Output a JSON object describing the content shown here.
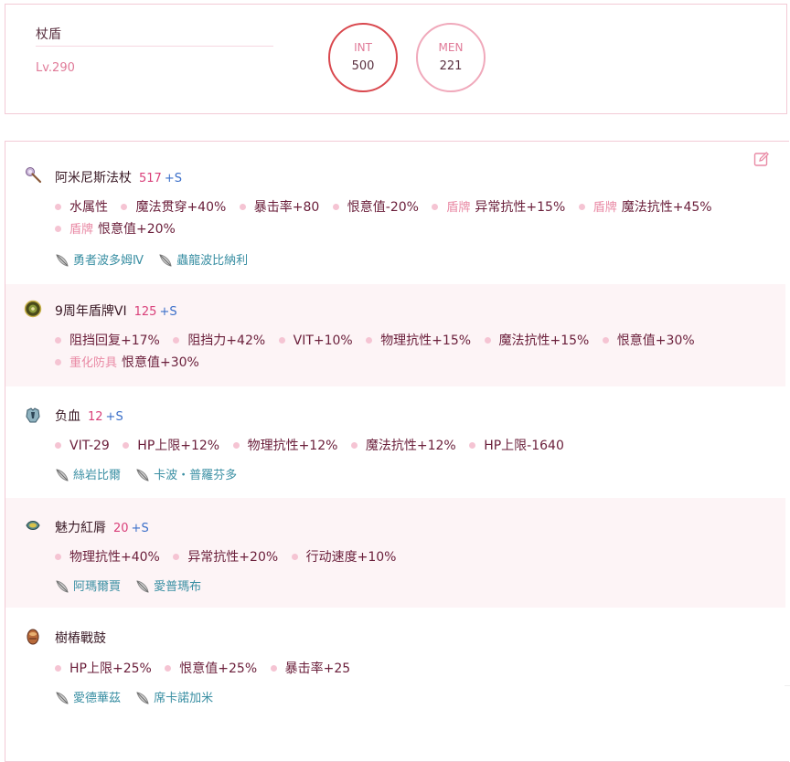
{
  "header": {
    "build_name": "杖盾",
    "level": "Lv.290",
    "stats": [
      {
        "label": "INT",
        "value": "500"
      },
      {
        "label": "MEN",
        "value": "221"
      }
    ]
  },
  "icons": {
    "edit": "edit-icon",
    "card": "card-feather-icon",
    "bullet": "bullet-dot"
  },
  "colors": {
    "accent_red": "#d9484e",
    "accent_pink": "#f0a9bb",
    "refine_pink": "#d9407a",
    "s_blue": "#3b6fc9",
    "card_teal": "#3a8fa3",
    "stat_text": "#6a1e3a"
  },
  "equipment": [
    {
      "name": "阿米尼斯法杖",
      "refine": "517",
      "suffix": "+S",
      "icon": "staff-icon",
      "stats_rows": [
        [
          {
            "prefix": "",
            "text": "水属性"
          },
          {
            "prefix": "",
            "text": "魔法贯穿+40%"
          },
          {
            "prefix": "",
            "text": "暴击率+80"
          },
          {
            "prefix": "",
            "text": "恨意值-20%"
          },
          {
            "prefix": "盾牌",
            "text": "异常抗性+15%"
          },
          {
            "prefix": "盾牌",
            "text": "魔法抗性+45%"
          }
        ],
        [
          {
            "prefix": "盾牌",
            "text": "恨意值+20%"
          }
        ]
      ],
      "cards": [
        "勇者波多姆Ⅳ",
        "蟲龍波比納利"
      ]
    },
    {
      "name": "9周年盾牌VI",
      "refine": "125",
      "suffix": "+S",
      "icon": "shield-icon",
      "stats_rows": [
        [
          {
            "prefix": "",
            "text": "阻挡回复+17%"
          },
          {
            "prefix": "",
            "text": "阻挡力+42%"
          },
          {
            "prefix": "",
            "text": "VIT+10%"
          },
          {
            "prefix": "",
            "text": "物理抗性+15%"
          },
          {
            "prefix": "",
            "text": "魔法抗性+15%"
          },
          {
            "prefix": "",
            "text": "恨意值+30%"
          }
        ],
        [
          {
            "prefix": "重化防具",
            "text": "恨意值+30%"
          }
        ]
      ],
      "cards": []
    },
    {
      "name": "负血",
      "refine": "12",
      "suffix": "+S",
      "icon": "armor-icon",
      "stats_rows": [
        [
          {
            "prefix": "",
            "text": "VIT-29"
          },
          {
            "prefix": "",
            "text": "HP上限+12%"
          },
          {
            "prefix": "",
            "text": "物理抗性+12%"
          },
          {
            "prefix": "",
            "text": "魔法抗性+12%"
          },
          {
            "prefix": "",
            "text": "HP上限-1640"
          }
        ]
      ],
      "cards": [
        "絲岩比爾",
        "卡波・普羅芬多"
      ]
    },
    {
      "name": "魅力紅脣",
      "refine": "20",
      "suffix": "+S",
      "icon": "accessory-icon",
      "stats_rows": [
        [
          {
            "prefix": "",
            "text": "物理抗性+40%"
          },
          {
            "prefix": "",
            "text": "异常抗性+20%"
          },
          {
            "prefix": "",
            "text": "行动速度+10%"
          }
        ]
      ],
      "cards": [
        "阿瑪爾賈",
        "愛普瑪布"
      ]
    },
    {
      "name": "樹樁戰鼓",
      "refine": "",
      "suffix": "",
      "icon": "special-icon",
      "stats_rows": [
        [
          {
            "prefix": "",
            "text": "HP上限+25%"
          },
          {
            "prefix": "",
            "text": "恨意值+25%"
          },
          {
            "prefix": "",
            "text": "暴击率+25"
          }
        ]
      ],
      "cards": [
        "愛德華茲",
        "席卡諾加米"
      ]
    }
  ]
}
